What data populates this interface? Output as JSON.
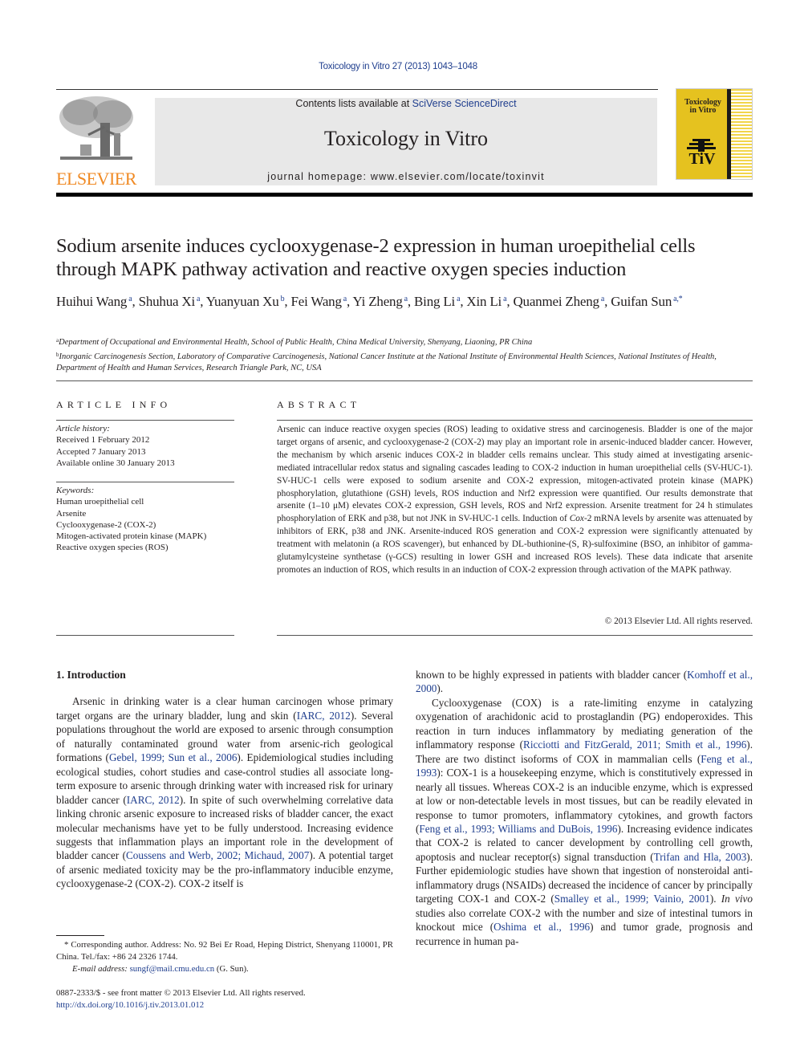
{
  "header": {
    "citation": "Toxicology in Vitro 27 (2013) 1043–1048",
    "contents_prefix": "Contents lists available at ",
    "contents_link": "SciVerse ScienceDirect",
    "journal_title": "Toxicology in Vitro",
    "homepage": "journal homepage: www.elsevier.com/locate/toxinvit",
    "publisher_logo_text": "ELSEVIER",
    "cover": {
      "title_line1": "Toxicology",
      "title_line2": "in Vitro",
      "emblem_text": "TiV",
      "accent_color": "#e5c21f"
    },
    "publisher_color": "#f08a24",
    "link_color": "#1f3e8e"
  },
  "article": {
    "title": "Sodium arsenite induces cyclooxygenase-2 expression in human uroepithelial cells through MAPK pathway activation and reactive oxygen species induction",
    "authors": [
      {
        "name": "Huihui Wang",
        "sup": "a"
      },
      {
        "name": "Shuhua Xi",
        "sup": "a"
      },
      {
        "name": "Yuanyuan Xu",
        "sup": "b"
      },
      {
        "name": "Fei Wang",
        "sup": "a"
      },
      {
        "name": "Yi Zheng",
        "sup": "a"
      },
      {
        "name": "Bing Li",
        "sup": "a"
      },
      {
        "name": "Xin Li",
        "sup": "a"
      },
      {
        "name": "Quanmei Zheng",
        "sup": "a"
      },
      {
        "name": "Guifan Sun",
        "sup": "a,*"
      }
    ],
    "affiliations": [
      {
        "mark": "a",
        "text": "Department of Occupational and Environmental Health, School of Public Health, China Medical University, Shenyang, Liaoning, PR China"
      },
      {
        "mark": "b",
        "text": "Inorganic Carcinogenesis Section, Laboratory of Comparative Carcinogenesis, National Cancer Institute at the National Institute of Environmental Health Sciences, National Institutes of Health, Department of Health and Human Services, Research Triangle Park, NC, USA"
      }
    ]
  },
  "article_info": {
    "heading": "ARTICLE INFO",
    "history_label": "Article history:",
    "history": [
      "Received 1 February 2012",
      "Accepted 7 January 2013",
      "Available online 30 January 2013"
    ],
    "keywords_label": "Keywords:",
    "keywords": [
      "Human uroepithelial cell",
      "Arsenite",
      "Cyclooxygenase-2 (COX-2)",
      "Mitogen-activated protein kinase (MAPK)",
      "Reactive oxygen species (ROS)"
    ]
  },
  "abstract": {
    "heading": "ABSTRACT",
    "p1": "Arsenic can induce reactive oxygen species (ROS) leading to oxidative stress and carcinogenesis. Bladder is one of the major target organs of arsenic, and cyclooxygenase-2 (COX-2) may play an important role in arsenic-induced bladder cancer. However, the mechanism by which arsenic induces COX-2 in bladder cells remains unclear. This study aimed at investigating arsenic-mediated intracellular redox status and signaling cascades leading to COX-2 induction in human uroepithelial cells (SV-HUC-1). SV-HUC-1 cells were exposed to sodium arsenite and COX-2 expression, mitogen-activated protein kinase (MAPK) phosphorylation, glutathione (GSH) levels, ROS induction and Nrf2 expression were quantified. Our results demonstrate that arsenite (1–10 μM) elevates COX-2 expression, GSH levels, ROS and Nrf2 expression. Arsenite treatment for 24 h stimulates phosphorylation of ERK and p38, but not JNK in SV-HUC-1 cells. Induction of ",
    "italic_term": "Cox",
    "p2": "-2 mRNA levels by arsenite was attenuated by inhibitors of ERK, p38 and JNK. Arsenite-induced ROS generation and COX-2 expression were significantly attenuated by treatment with melatonin (a ROS scavenger), but enhanced by DL-buthionine-(S, R)-sulfoximine (BSO, an inhibitor of gamma-glutamylcysteine synthetase (γ-GCS) resulting in lower GSH and increased ROS levels). These data indicate that arsenite promotes an induction of ROS, which results in an induction of COX-2 expression through activation of the MAPK pathway.",
    "copyright": "© 2013 Elsevier Ltd. All rights reserved."
  },
  "introduction": {
    "heading": "1. Introduction",
    "left": [
      {
        "t": "Arsenic in drinking water is a clear human carcinogen whose primary target organs are the urinary bladder, lung and skin ("
      },
      {
        "l": "IARC, 2012"
      },
      {
        "t": "). Several populations throughout the world are exposed to arsenic through consumption of naturally contaminated ground water from arsenic-rich geological formations ("
      },
      {
        "l": "Gebel, 1999; Sun et al., 2006"
      },
      {
        "t": "). Epidemiological studies including ecological studies, cohort studies and case-control studies all associate long-term exposure to arsenic through drinking water with increased risk for urinary bladder cancer ("
      },
      {
        "l": "IARC, 2012"
      },
      {
        "t": "). In spite of such overwhelming correlative data linking chronic arsenic exposure to increased risks of bladder cancer, the exact molecular mechanisms have yet to be fully understood. Increasing evidence suggests that inflammation plays an important role in the development of bladder cancer ("
      },
      {
        "l": "Coussens and Werb, 2002; Michaud, 2007"
      },
      {
        "t": "). A potential target of arsenic mediated toxicity may be the pro-inflammatory inducible enzyme, cyclooxygenase-2 (COX-2). COX-2 itself is"
      }
    ],
    "right_p1": [
      {
        "t": "known to be highly expressed in patients with bladder cancer ("
      },
      {
        "l": "Komhoff et al., 2000"
      },
      {
        "t": ")."
      }
    ],
    "right_p2": [
      {
        "t": "Cyclooxygenase (COX) is a rate-limiting enzyme in catalyzing oxygenation of arachidonic acid to prostaglandin (PG) endoperoxides. This reaction in turn induces inflammatory by mediating generation of the inflammatory response ("
      },
      {
        "l": "Ricciotti and FitzGerald, 2011; Smith et al., 1996"
      },
      {
        "t": "). There are two distinct isoforms of COX in mammalian cells ("
      },
      {
        "l": "Feng et al., 1993"
      },
      {
        "t": "): COX-1 is a housekeeping enzyme, which is constitutively expressed in nearly all tissues. Whereas COX-2 is an inducible enzyme, which is expressed at low or non-detectable levels in most tissues, but can be readily elevated in response to tumor promoters, inflammatory cytokines, and growth factors ("
      },
      {
        "l": "Feng et al., 1993; Williams and DuBois, 1996"
      },
      {
        "t": "). Increasing evidence indicates that COX-2 is related to cancer development by controlling cell growth, apoptosis and nuclear receptor(s) signal transduction ("
      },
      {
        "l": "Trifan and Hla, 2003"
      },
      {
        "t": "). Further epidemiologic studies have shown that ingestion of nonsteroidal anti-inflammatory drugs (NSAIDs) decreased the incidence of cancer by principally targeting COX-1 and COX-2 ("
      },
      {
        "l": "Smalley et al., 1999; Vainio, 2001"
      },
      {
        "t": "). "
      },
      {
        "i": "In vivo"
      },
      {
        "t": " studies also correlate COX-2 with the number and size of intestinal tumors in knockout mice ("
      },
      {
        "l": "Oshima et al., 1996"
      },
      {
        "t": ") and tumor grade, prognosis and recurrence in human pa-"
      }
    ]
  },
  "footnotes": {
    "corresponding": "* Corresponding author. Address: No. 92 Bei Er Road, Heping District, Shenyang 110001, PR China. Tel./fax: +86 24 2326 1744.",
    "email_label": "E-mail address: ",
    "email": "sungf@mail.cmu.edu.cn",
    "email_suffix": " (G. Sun).",
    "issn_line": "0887-2333/$ - see front matter © 2013 Elsevier Ltd. All rights reserved.",
    "doi": "http://dx.doi.org/10.1016/j.tiv.2013.01.012"
  }
}
